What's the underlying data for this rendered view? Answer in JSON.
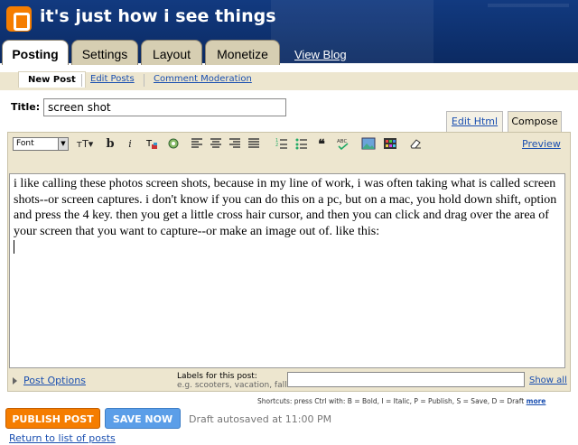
{
  "header": {
    "blog_title": "it's just how i see things"
  },
  "tabs": [
    {
      "label": "Posting",
      "active": true
    },
    {
      "label": "Settings",
      "active": false
    },
    {
      "label": "Layout",
      "active": false
    },
    {
      "label": "Monetize",
      "active": false
    }
  ],
  "view_blog": "View Blog",
  "subtabs": [
    {
      "label": "New Post",
      "active": true
    },
    {
      "label": "Edit Posts",
      "active": false
    },
    {
      "label": "Comment Moderation",
      "active": false
    }
  ],
  "title_field": {
    "label": "Title:",
    "value": "screen shot"
  },
  "modes": {
    "edit_html": "Edit Html",
    "compose": "Compose"
  },
  "toolbar": {
    "font_label": "Font",
    "preview": "Preview"
  },
  "body_text": "i like calling these photos screen shots, because in my line of work, i was often taking what is called screen shots--or screen captures. i don't know if you can do this on a pc, but on a mac, you hold down shift, option and press the 4 key. then you get a little cross hair cursor, and then you can click and drag over the area of your screen that you want to capture--or make an image out of. like this:",
  "post_options": "Post Options",
  "labels": {
    "title": "Labels for this post:",
    "hint": "e.g. scooters, vacation, fall",
    "value": "",
    "show_all": "Show all"
  },
  "shortcuts": {
    "text": "Shortcuts: press Ctrl with: B = Bold, I = Italic, P = Publish, S = Save, D = Draft",
    "more": "more"
  },
  "buttons": {
    "publish": "PUBLISH POST",
    "save": "SAVE NOW"
  },
  "autosave": "Draft autosaved at 11:00 PM",
  "return_link": "Return to list of posts",
  "colors": {
    "header": "#0d3170",
    "tab": "#d6ceb2",
    "editor": "#ede6cf",
    "publish": "#f57d00",
    "save": "#5b9ee8",
    "link": "#1a4fb0"
  }
}
